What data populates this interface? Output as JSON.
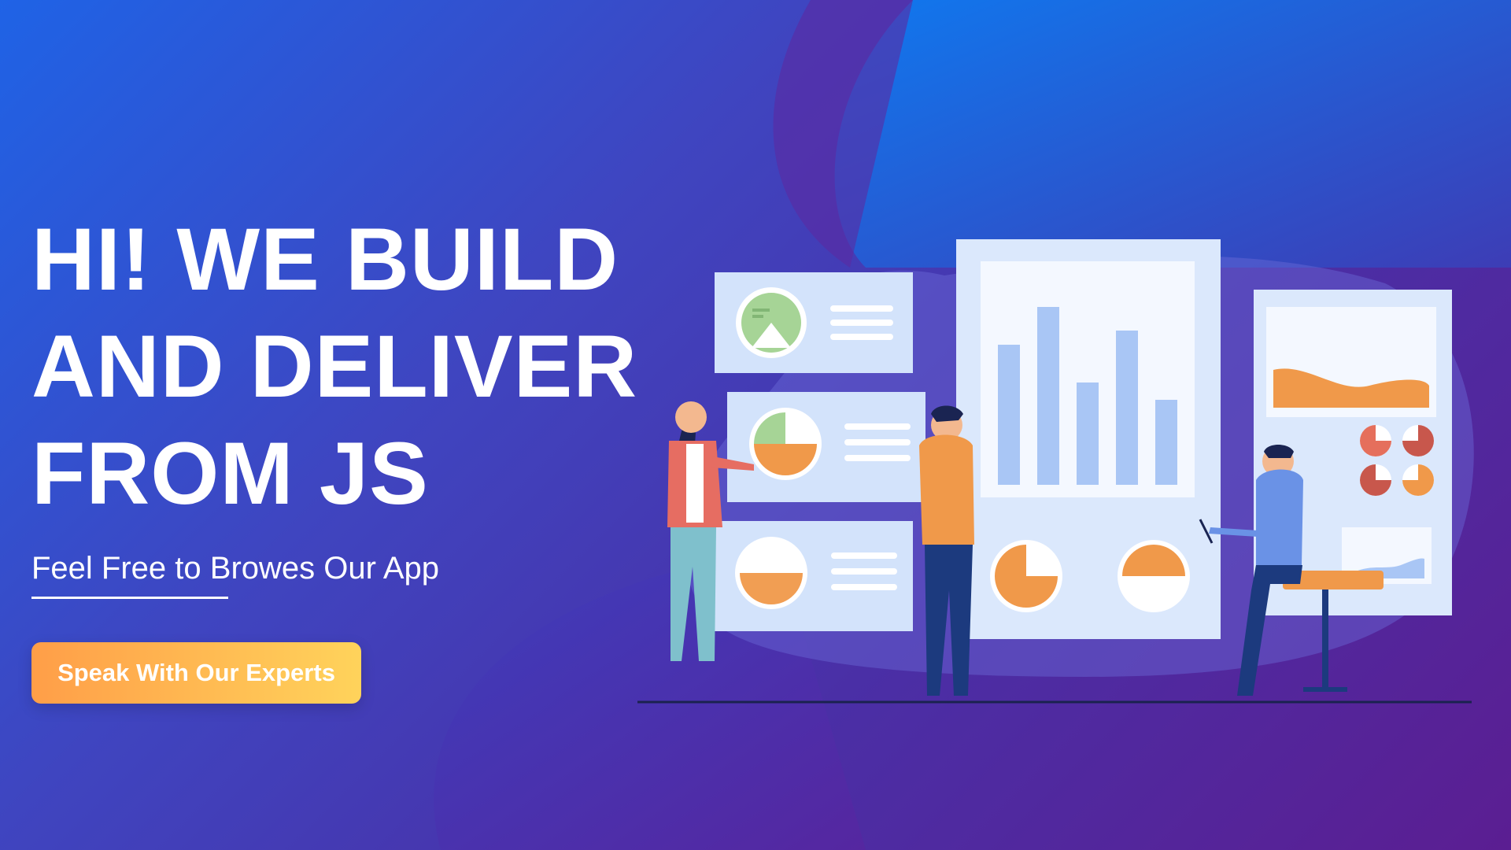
{
  "hero": {
    "headline_lines": [
      "HI! WE BUILD",
      "AND DELIVER",
      "FROM JS"
    ],
    "subtitle": "Feel Free to Browes Our App"
  },
  "cta": {
    "label": "Speak With Our Experts"
  },
  "illustration": {
    "subject": "people presenting dashboard charts",
    "icons": [
      "pie-chart-icon",
      "bar-chart-icon",
      "area-chart-icon"
    ]
  },
  "colors": {
    "accent_orange": "#f0994a",
    "chart_blue": "#a9c6f5",
    "chart_green": "#a6d496",
    "panel": "#d9e6fb",
    "cta_start": "#ff9e48",
    "cta_end": "#ffd35b"
  }
}
